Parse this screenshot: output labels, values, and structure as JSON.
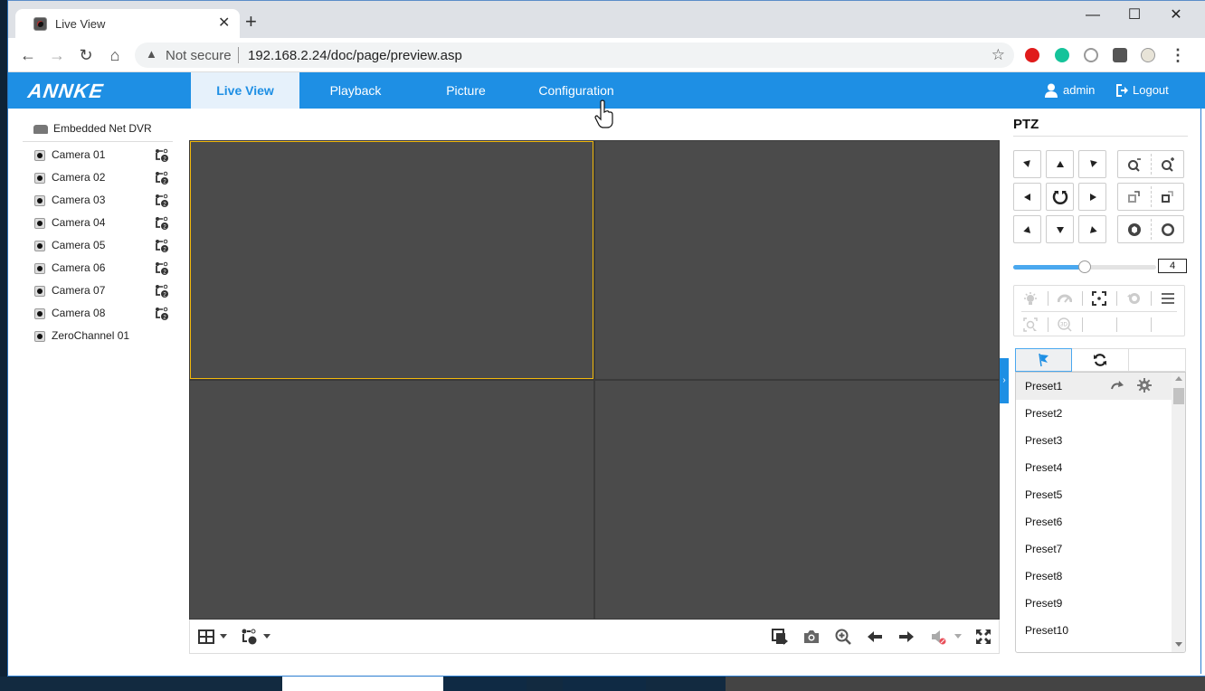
{
  "browser": {
    "tab_title": "Live View",
    "tab_close": "✕",
    "new_tab": "+",
    "window_controls": {
      "minimize": "—",
      "maximize": "☐",
      "close": "✕"
    },
    "nav": {
      "back": "←",
      "forward": "→",
      "reload": "↻",
      "home": "⌂"
    },
    "security_icon": "▲",
    "security_text": "Not secure",
    "url": "192.168.2.24/doc/page/preview.asp",
    "bookmark_icon": "☆",
    "menu_icon": "⋮",
    "extensions": [
      "adblock-icon",
      "grammarly-icon",
      "link-extension-icon",
      "puzzle-icon",
      "profile-avatar-icon"
    ]
  },
  "app": {
    "logo": "ANNKE",
    "menu": [
      {
        "label": "Live View",
        "active": true
      },
      {
        "label": "Playback",
        "active": false
      },
      {
        "label": "Picture",
        "active": false
      },
      {
        "label": "Configuration",
        "active": false
      }
    ],
    "user": "admin",
    "logout": "Logout",
    "accent_color": "#1e8fe4"
  },
  "sidebar": {
    "device": "Embedded Net DVR",
    "channels": [
      {
        "label": "Camera 01",
        "has_stream_toggle": true
      },
      {
        "label": "Camera 02",
        "has_stream_toggle": true
      },
      {
        "label": "Camera 03",
        "has_stream_toggle": true
      },
      {
        "label": "Camera 04",
        "has_stream_toggle": true
      },
      {
        "label": "Camera 05",
        "has_stream_toggle": true
      },
      {
        "label": "Camera 06",
        "has_stream_toggle": true
      },
      {
        "label": "Camera 07",
        "has_stream_toggle": true
      },
      {
        "label": "Camera 08",
        "has_stream_toggle": true
      },
      {
        "label": "ZeroChannel 01",
        "has_stream_toggle": false
      }
    ]
  },
  "video": {
    "layout": "2x2",
    "selected_pane": 1,
    "selected_color": "#f2b90c",
    "toolbar_left": [
      "window-layout-icon",
      "stream-type-icon"
    ],
    "toolbar_right": [
      "stop-all-preview-icon",
      "capture-icon",
      "digital-zoom-icon",
      "previous-page-icon",
      "next-page-icon",
      "audio-muted-icon",
      "fullscreen-icon"
    ]
  },
  "ptz": {
    "title": "PTZ",
    "speed_value": "4",
    "speed_fraction": 0.5,
    "tabs": [
      "preset-tab",
      "patrol-tab",
      "pattern-tab"
    ],
    "active_tab": 0,
    "presets": [
      "Preset1",
      "Preset2",
      "Preset3",
      "Preset4",
      "Preset5",
      "Preset6",
      "Preset7",
      "Preset8",
      "Preset9",
      "Preset10"
    ],
    "hovered_preset": 0
  }
}
